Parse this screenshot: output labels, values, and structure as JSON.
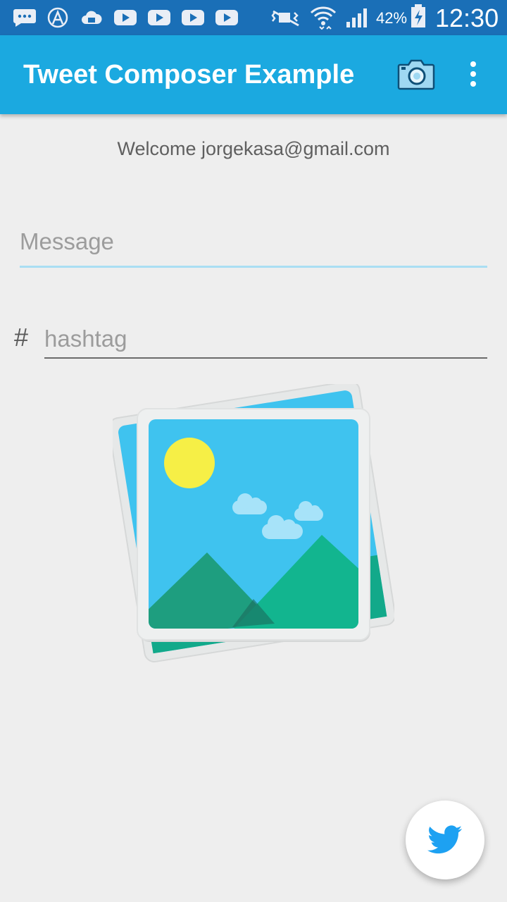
{
  "status_bar": {
    "battery": "42%",
    "time": "12:30",
    "icons": [
      "message-icon",
      "app-icon",
      "cloud-icon",
      "youtube-icon",
      "youtube-icon",
      "youtube-icon",
      "youtube-icon",
      "mute-icon",
      "wifi-icon",
      "signal-icon",
      "battery-charging-icon"
    ]
  },
  "app_bar": {
    "title": "Tweet Composer Example",
    "actions": [
      "camera-icon",
      "more-vert-icon"
    ]
  },
  "welcome": "Welcome jorgekasa@gmail.com",
  "message_field": {
    "placeholder": "Message",
    "value": ""
  },
  "hashtag_field": {
    "prefix": "#",
    "placeholder": "hashtag",
    "value": ""
  },
  "image_placeholder": {
    "icon": "image-placeholder-icon"
  },
  "fab": {
    "icon": "twitter-bird-icon"
  },
  "colors": {
    "status_bar": "#1a6fb7",
    "app_bar": "#1ba9e0",
    "background": "#eeeeee",
    "accent": "#a9def3",
    "twitter_blue": "#1da1f2"
  }
}
